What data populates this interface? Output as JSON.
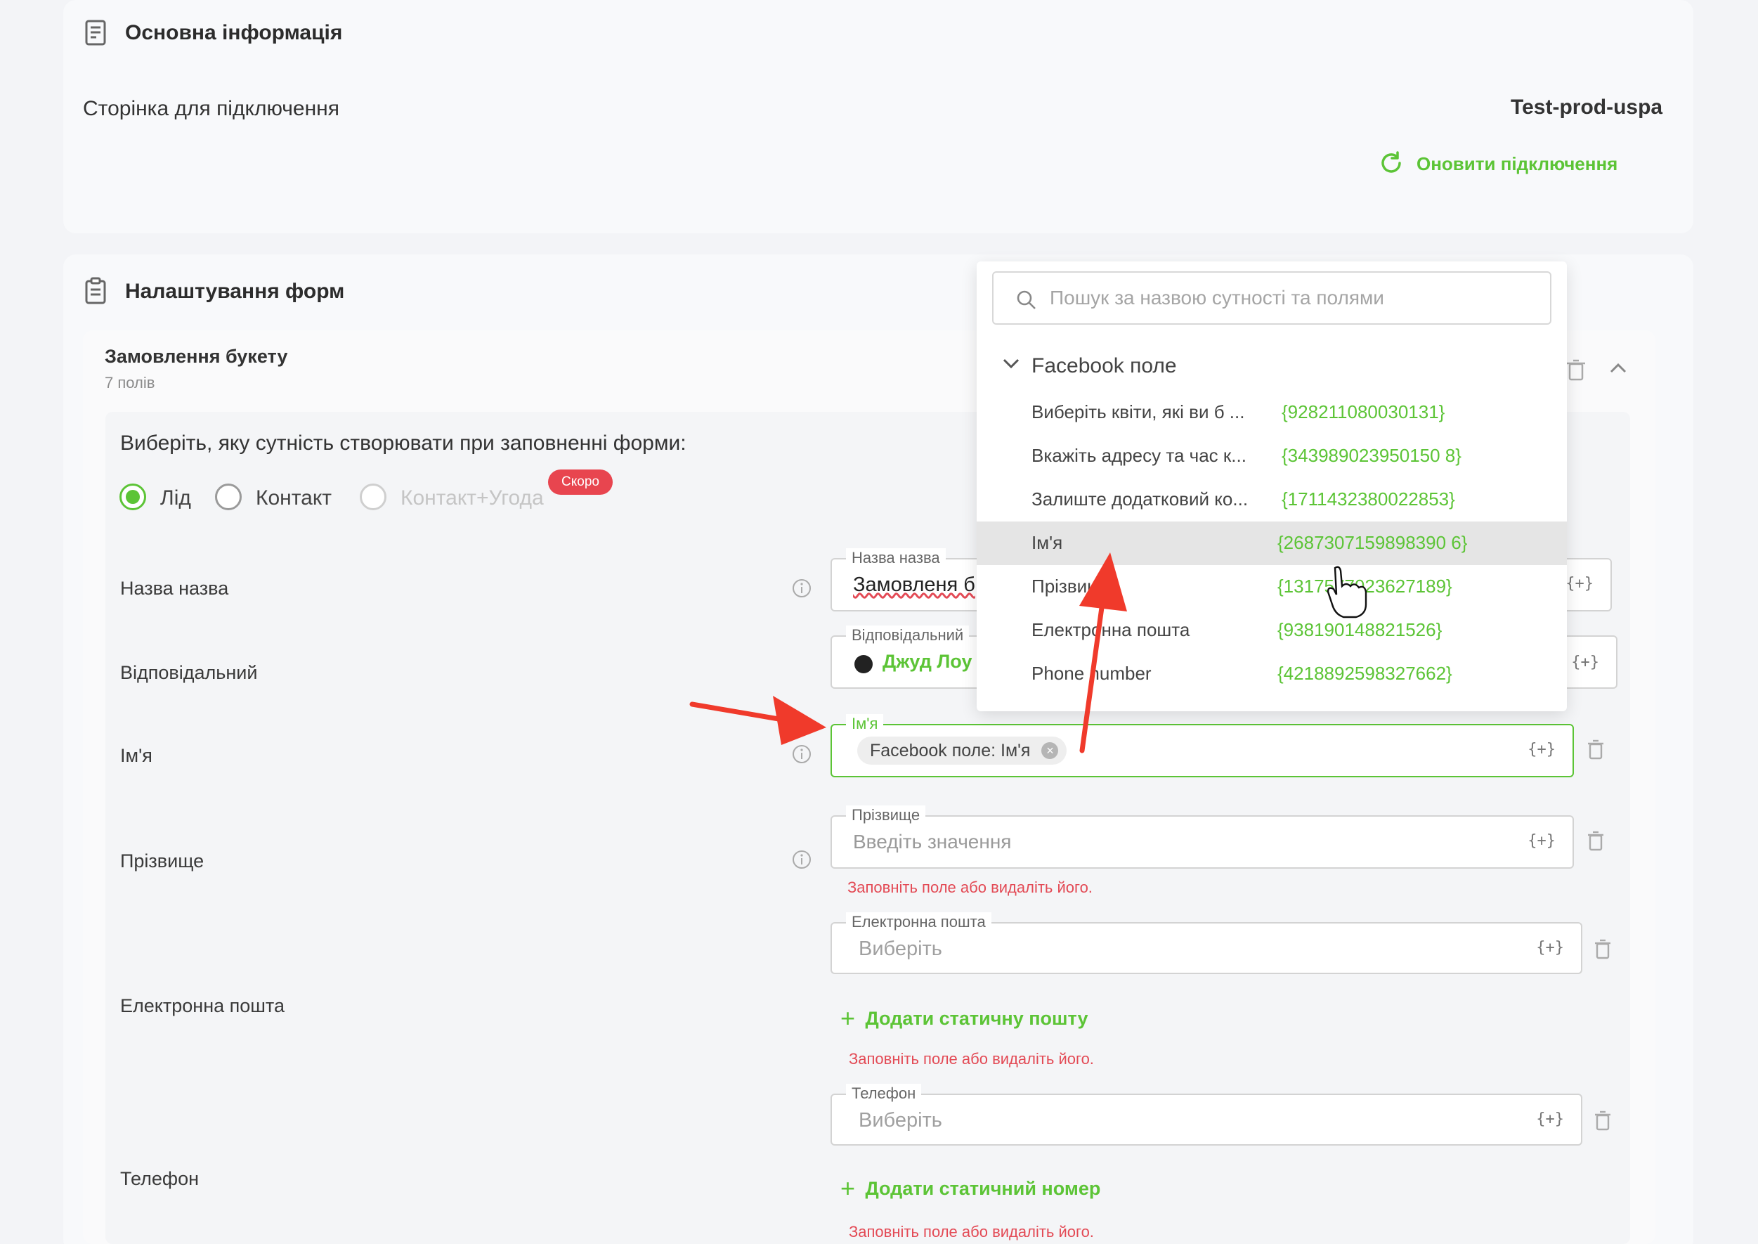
{
  "basic_info": {
    "title": "Основна інформація",
    "page_label": "Сторінка для підключення",
    "page_value": "Test-prod-uspa",
    "refresh_label": "Оновити підключення"
  },
  "forms": {
    "title": "Налаштування форм",
    "form_name": "Замовлення букету",
    "fields_count": "7 полів",
    "entity_question": "Виберіть, яку сутність створювати при заповненні форми:",
    "entities": [
      {
        "label": "Лід",
        "selected": true
      },
      {
        "label": "Контакт",
        "selected": false
      },
      {
        "label": "Контакт+Угода",
        "selected": false,
        "badge": "Скоро"
      }
    ],
    "rows": {
      "name_title": {
        "label": "Назва назва",
        "field_label": "Назва назва",
        "value": "Замовленя б"
      },
      "responsible": {
        "label": "Відповідальний",
        "field_label": "Відповідальний",
        "value": "Джуд Лоу"
      },
      "first_name": {
        "label": "Ім'я",
        "field_label": "Ім'я",
        "chip": "Facebook поле: Ім'я"
      },
      "last_name": {
        "label": "Прізвище",
        "field_label": "Прізвище",
        "placeholder": "Введіть значення",
        "error": "Заповніть поле або видаліть його."
      },
      "email": {
        "label": "Електронна пошта",
        "field_label": "Електронна пошта",
        "placeholder": "Виберіть",
        "add_static": "Додати статичну пошту",
        "error": "Заповніть поле або видаліть його."
      },
      "phone": {
        "label": "Телефон",
        "field_label": "Телефон",
        "placeholder": "Виберіть",
        "add_static": "Додати статичний номер",
        "error": "Заповніть поле або видаліть його."
      }
    },
    "plus_token": "{+}"
  },
  "dropdown": {
    "search_placeholder": "Пошук за назвою сутності та полями",
    "group_title": "Facebook поле",
    "items": [
      {
        "name": "Виберіть квіти, які ви б ...",
        "code": "{928211080030131}"
      },
      {
        "name": "Вкажіть адресу та час к...",
        "code": "{343989023950150 8}"
      },
      {
        "name": "Залиште додатковий ко...",
        "code": "{1711432380022853}"
      },
      {
        "name": "Ім'я",
        "code": "{2687307159898390 6}"
      },
      {
        "name": "Прізвище",
        "code": "{1317577023627189}"
      },
      {
        "name": "Електронна пошта",
        "code": "{938190148821526}"
      },
      {
        "name": "Phone number",
        "code": "{4218892598327662}"
      }
    ]
  },
  "colors": {
    "accent": "#5cc436",
    "error": "#e34a55",
    "badge": "#e8454f",
    "arrow": "#f03a2b"
  }
}
